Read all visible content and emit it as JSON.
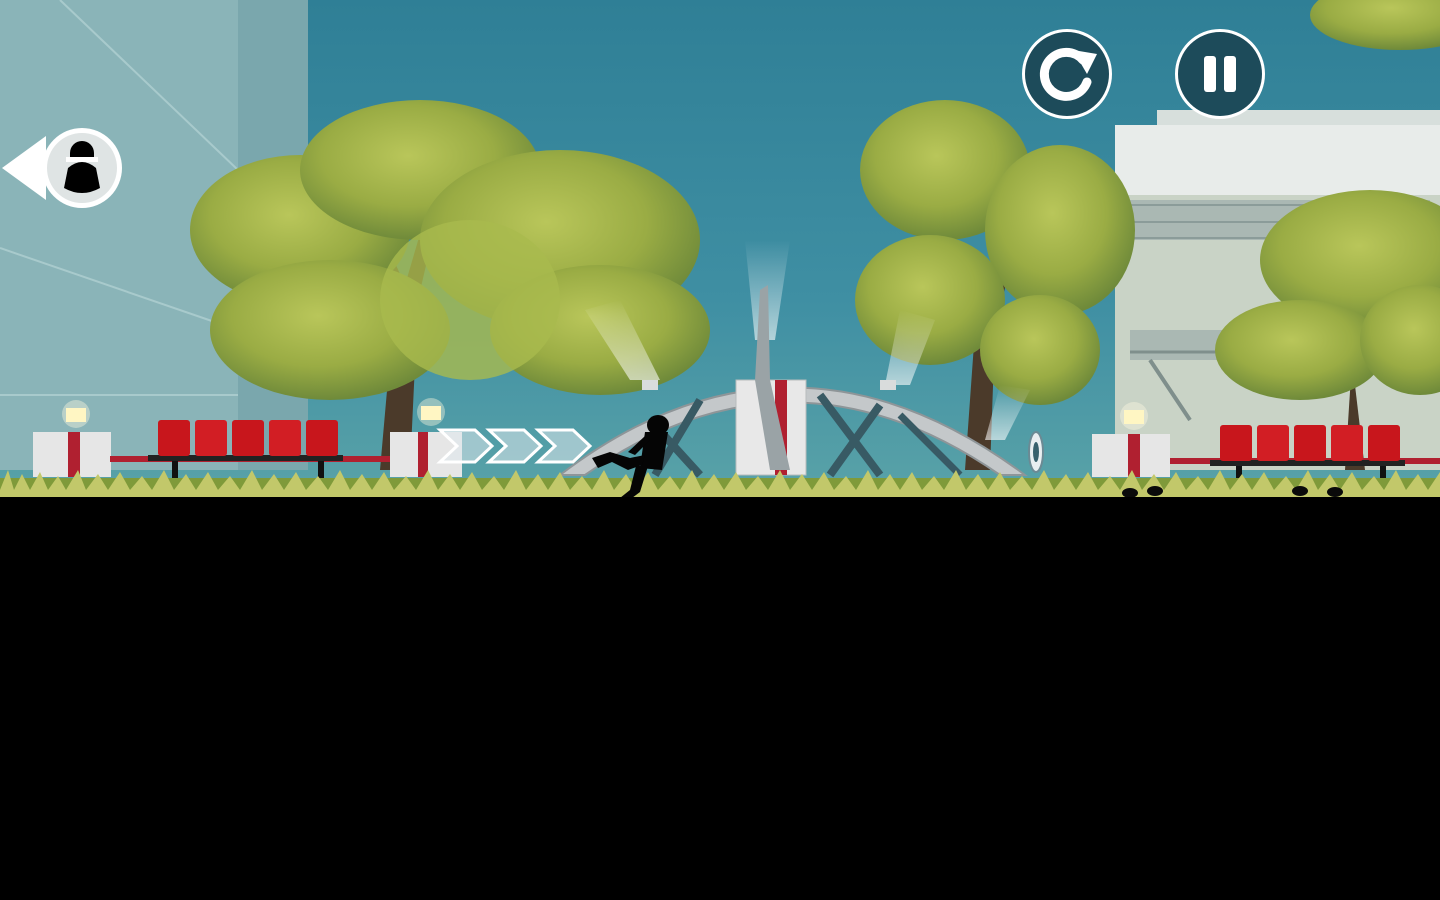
{
  "game": {
    "hud": {
      "restart_icon": "restart-icon",
      "pause_icon": "pause-icon",
      "chaser_indicator_icon": "hunter-indicator-icon"
    },
    "colors": {
      "sky": "#3f8fa3",
      "hud_fill": "#1d4b5a",
      "foliage": "#9fb043",
      "seat_red": "#c8161c",
      "ground": "#000000"
    }
  }
}
